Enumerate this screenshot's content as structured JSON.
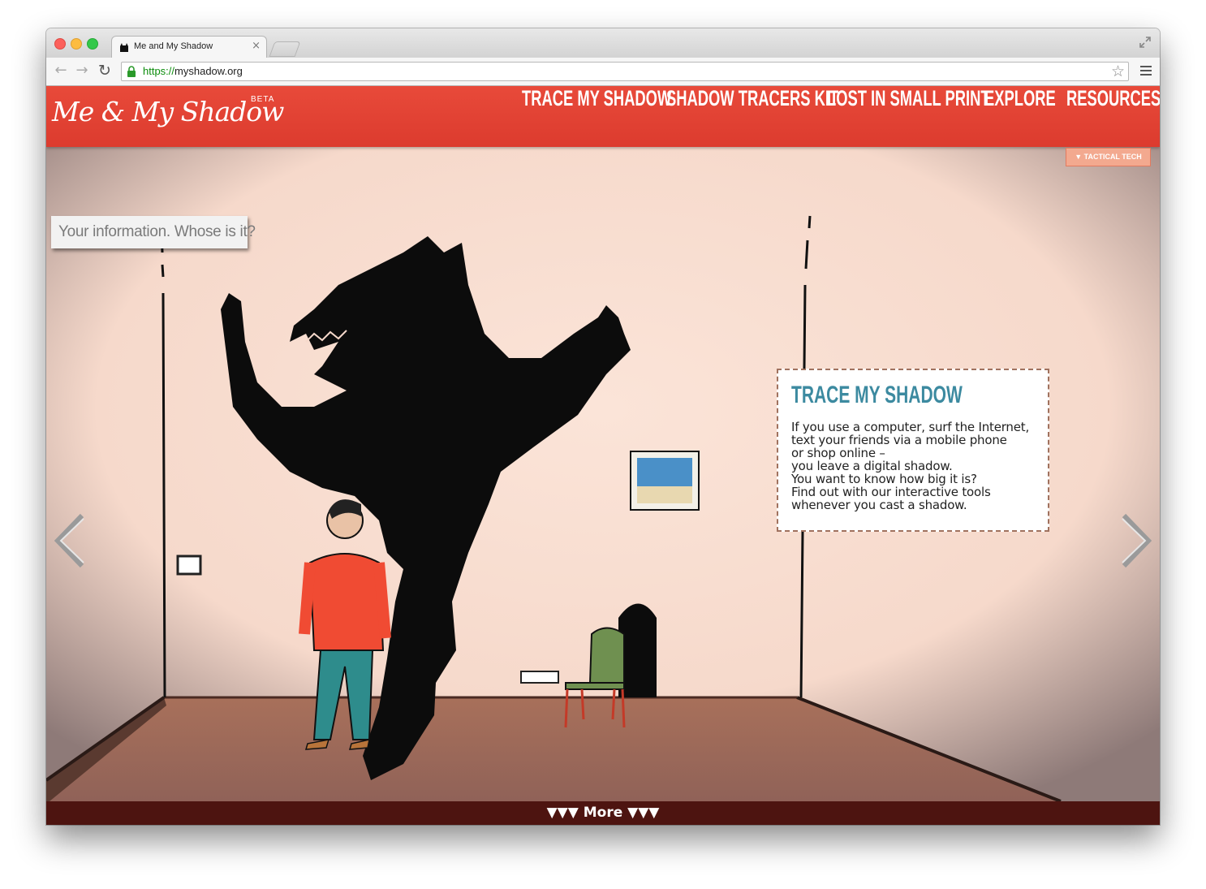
{
  "browser": {
    "tab_title": "Me and My Shadow",
    "tab_close": "×",
    "url_scheme": "https://",
    "url_host": "myshadow.org",
    "icons": [
      "back-arrow-icon",
      "forward-arrow-icon",
      "reload-icon",
      "lock-icon",
      "star-icon",
      "menu-icon",
      "fullscreen-icon"
    ]
  },
  "site": {
    "logo": "Me & My Shadow",
    "logo_badge": "BETA",
    "nav": [
      "TRACE MY SHADOW",
      "SHADOW TRACERS KIT",
      "LOST IN SMALL PRINT",
      "EXPLORE",
      "RESOURCES"
    ],
    "tactical_tech": "▼ TACTICAL TECH",
    "tagline": "Your information. Whose is it?",
    "brand_color": "#e0402f"
  },
  "infobox": {
    "title": "TRACE MY SHADOW",
    "lines": [
      "If you use a computer, surf the Internet,",
      "text your friends via a mobile phone",
      "or shop online –",
      "you leave a digital shadow.",
      "You want to know how big it is?",
      "Find out with our interactive tools",
      "whenever you cast a shadow."
    ]
  },
  "footer": {
    "more_label": "▼▼▼ More ▼▼▼"
  }
}
